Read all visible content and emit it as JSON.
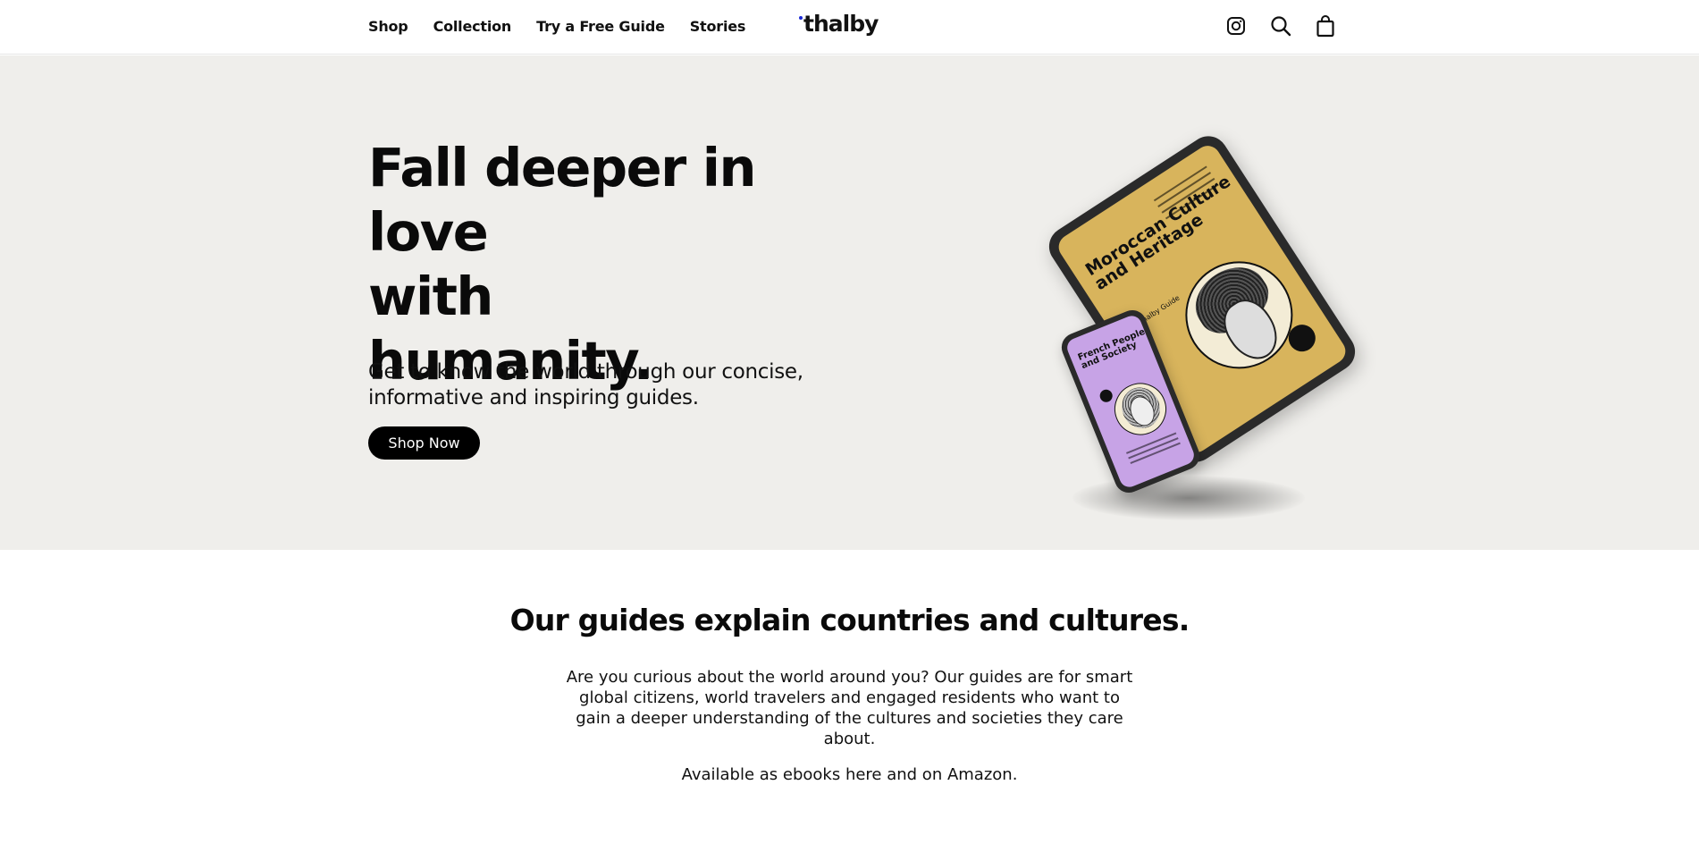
{
  "header": {
    "nav": [
      {
        "label": "Shop"
      },
      {
        "label": "Collection"
      },
      {
        "label": "Try a Free Guide"
      },
      {
        "label": "Stories"
      }
    ],
    "logo": "thalby",
    "icons": [
      "instagram-icon",
      "search-icon",
      "shopping-bag-icon"
    ]
  },
  "hero": {
    "title_line1": "Fall deeper in love",
    "title_line2": "with",
    "title_line3": "humanity.",
    "subtitle": "Get to know the world through our concise, informative and inspiring guides.",
    "cta": "Shop Now",
    "tablet": {
      "title": "Moroccan Culture and Heritage",
      "subtitle": "The Thalby Guide",
      "screen_color": "#d8b45c"
    },
    "phone": {
      "title": "French People and Society",
      "screen_color": "#c7a3e6"
    },
    "background": "#efeeeb"
  },
  "intro": {
    "title": "Our guides explain countries and cultures.",
    "body": "Are you curious about the world around you? Our guides are for smart global citizens, world travelers and engaged residents who want to gain a deeper understanding of the cultures and societies they care about.",
    "note": "Available as ebooks here and on Amazon."
  },
  "colors": {
    "logo_dot": "#1c2bd6",
    "button": "#000000"
  }
}
